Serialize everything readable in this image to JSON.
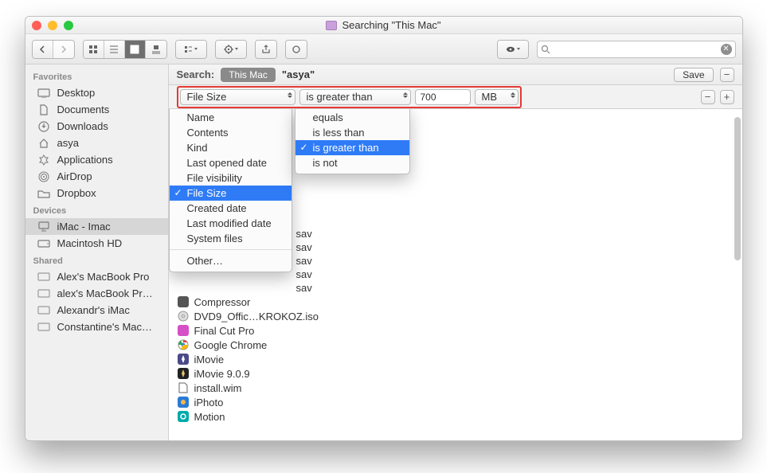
{
  "window": {
    "title": "Searching \"This Mac\""
  },
  "sidebar": {
    "sections": [
      {
        "label": "Favorites",
        "items": [
          {
            "icon": "desktop",
            "label": "Desktop"
          },
          {
            "icon": "doc",
            "label": "Documents"
          },
          {
            "icon": "download",
            "label": "Downloads"
          },
          {
            "icon": "home",
            "label": "asya"
          },
          {
            "icon": "apps",
            "label": "Applications"
          },
          {
            "icon": "airdrop",
            "label": "AirDrop"
          },
          {
            "icon": "folder",
            "label": "Dropbox"
          }
        ]
      },
      {
        "label": "Devices",
        "items": [
          {
            "icon": "imac",
            "label": "iMac - Imac",
            "selected": true
          },
          {
            "icon": "disk",
            "label": "Macintosh HD"
          }
        ]
      },
      {
        "label": "Shared",
        "items": [
          {
            "icon": "monitor",
            "label": "Alex's MacBook Pro"
          },
          {
            "icon": "monitor",
            "label": "alex's MacBook Pr…"
          },
          {
            "icon": "monitor",
            "label": "Alexandr's iMac"
          },
          {
            "icon": "monitor",
            "label": "Constantine's Mac…"
          }
        ]
      }
    ]
  },
  "searchbar": {
    "label": "Search:",
    "scope_active": "This Mac",
    "scope_other": "\"asya\"",
    "save": "Save"
  },
  "criteria": {
    "attr_selected": "File Size",
    "op_selected": "is greater than",
    "value": "700",
    "unit": "MB"
  },
  "dropdown_attr": {
    "items": [
      "Name",
      "Contents",
      "Kind",
      "Last opened date",
      "File visibility",
      "File Size",
      "Created date",
      "Last modified date",
      "System files"
    ],
    "other": "Other…",
    "selected": "File Size"
  },
  "dropdown_op": {
    "items": [
      "equals",
      "is less than",
      "is greater than",
      "is not"
    ],
    "selected": "is greater than"
  },
  "files": [
    {
      "txt": "sav"
    },
    {
      "txt": "sav"
    },
    {
      "txt": "sav"
    },
    {
      "txt": "sav"
    },
    {
      "txt": "sav"
    },
    {
      "icon": "app",
      "label": "Compressor"
    },
    {
      "icon": "iso",
      "label": "DVD9_Offic…KROKOZ.iso"
    },
    {
      "icon": "fcp",
      "label": "Final Cut Pro"
    },
    {
      "icon": "chrome",
      "label": "Google Chrome"
    },
    {
      "icon": "imovie",
      "label": "iMovie"
    },
    {
      "icon": "imovie",
      "label": "iMovie 9.0.9"
    },
    {
      "icon": "file",
      "label": "install.wim"
    },
    {
      "icon": "iphoto",
      "label": "iPhoto"
    },
    {
      "icon": "motion",
      "label": "Motion"
    }
  ]
}
